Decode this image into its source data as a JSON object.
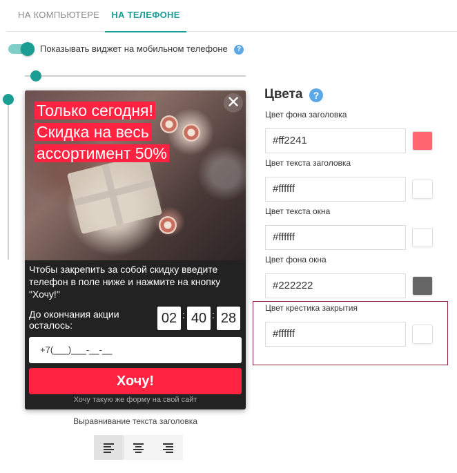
{
  "tabs": [
    {
      "label": "НА КОМПЬЮТЕРЕ",
      "active": false
    },
    {
      "label": "НА ТЕЛЕФОНЕ",
      "active": true
    }
  ],
  "mobile_toggle": {
    "label": "Показывать виджет на мобильном телефоне",
    "enabled": true,
    "help": "?"
  },
  "preview": {
    "headline": [
      "Только сегодня!",
      "Скидка на весь",
      "ассортимент 50%"
    ],
    "close_symbol": "✕",
    "body": "Чтобы закрепить за собой скидку введите телефон в поле ниже и нажмите на кнопку \"Хочу!\"",
    "timer_label": "До окончания акции осталось:",
    "timer": {
      "h": "02",
      "m": "40",
      "s": "28",
      "sep": ":"
    },
    "phone_placeholder": "+7(___)___-__-__",
    "cta": "Хочу!",
    "footer": "Хочу такую же форму на свой сайт"
  },
  "alignment": {
    "label": "Выравнивание текста заголовка",
    "options": [
      "left",
      "center",
      "right"
    ],
    "selected": "left"
  },
  "colors": {
    "title": "Цвета",
    "help": "?",
    "fields": [
      {
        "label": "Цвет фона заголовка",
        "value": "#ff2241",
        "swatch": "#ff6670"
      },
      {
        "label": "Цвет текста заголовка",
        "value": "#ffffff",
        "swatch": "#ffffff"
      },
      {
        "label": "Цвет текста окна",
        "value": "#ffffff",
        "swatch": "#ffffff"
      },
      {
        "label": "Цвет фона окна",
        "value": "#222222",
        "swatch": "#666666"
      },
      {
        "label": "Цвет крестика закрытия",
        "value": "#ffffff",
        "swatch": "#ffffff"
      }
    ]
  },
  "theme": {
    "accent": "#1a9e93",
    "cta": "#ff2241",
    "highlight_border": "#8a1f34"
  }
}
